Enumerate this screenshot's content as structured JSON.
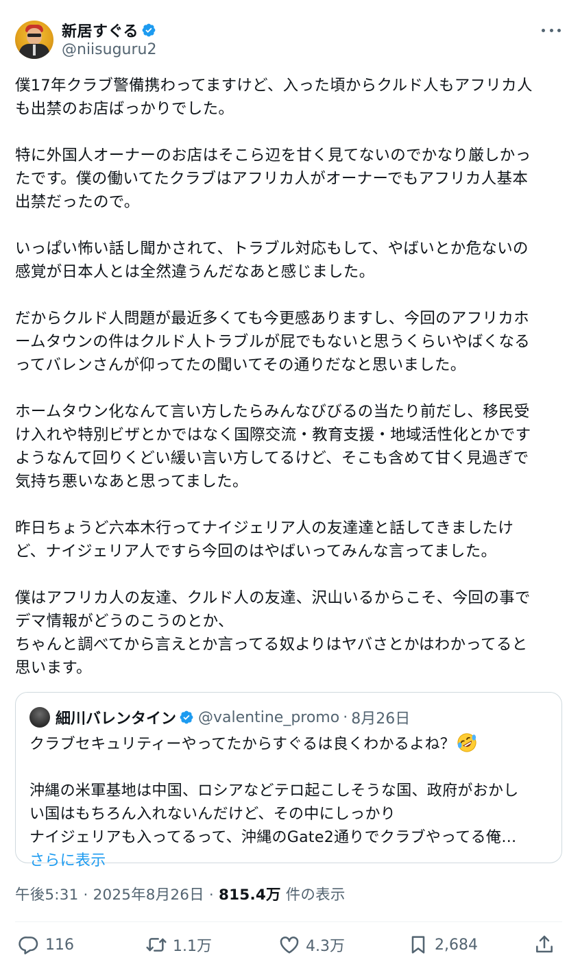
{
  "author": {
    "display_name": "新居すぐる",
    "handle": "@niisuguru2"
  },
  "tweet": {
    "paragraphs": [
      [
        "僕17年クラブ警備携わってますけど、入った頃からクルド人もアフリカ人",
        "も出禁のお店ばっかりでした。"
      ],
      [
        "特に外国人オーナーのお店はそこら辺を甘く見てないのでかなり厳しかっ",
        "たです。僕の働いてたクラブはアフリカ人がオーナーでもアフリカ人基本",
        "出禁だったので。"
      ],
      [
        "いっぱい怖い話し聞かされて、トラブル対応もして、やばいとか危ないの",
        "感覚が日本人とは全然違うんだなあと感じました。"
      ],
      [
        "だからクルド人問題が最近多くても今更感ありますし、今回のアフリカホ",
        "ームタウンの件はクルド人トラブルが屁でもないと思うくらいやばくなる",
        "ってバレンさんが仰ってたの聞いてその通りだなと思いました。"
      ],
      [
        "ホームタウン化なんて言い方したらみんなびびるの当たり前だし、移民受",
        "け入れや特別ビザとかではなく国際交流・教育支援・地域活性化とかです",
        "ようなんて回りくどい緩い言い方してるけど、そこも含めて甘く見過ぎで",
        "気持ち悪いなあと思ってました。"
      ],
      [
        "昨日ちょうど六本木行ってナイジェリア人の友達達と話してきましたけ",
        "ど、ナイジェリア人ですら今回のはやばいってみんな言ってました。"
      ],
      [
        "僕はアフリカ人の友達、クルド人の友達、沢山いるからこそ、今回の事で",
        "デマ情報がどうのこうのとか、",
        "ちゃんと調べてから言えとか言ってる奴よりはヤバさとかはわかってると",
        "思います。"
      ]
    ]
  },
  "quote": {
    "display_name": "細川バレンタイン",
    "handle": "@valentine_promo",
    "separator": "·",
    "date": "8月26日",
    "first_line": "クラブセキュリティーやってたからすぐるは良くわかるよね？",
    "emoji": "rolling-on-floor-laughing-emoji",
    "lines": [
      "沖縄の米軍基地は中国、ロシアなどテロ起こしそうな国、政府がおかし",
      "い国はもちろん入れないんだけど、その中にしっかり",
      "ナイジェリアも入ってるって、沖縄のGate2通りでクラブやってる俺…"
    ],
    "show_more": "さらに表示"
  },
  "meta": {
    "time": "午後5:31",
    "sep1": " · ",
    "date": "2025年8月26日",
    "sep2": " · ",
    "views": "815.4万",
    "views_label": " 件の表示"
  },
  "actions": {
    "replies": "116",
    "reposts": "1.1万",
    "likes": "4.3万",
    "bookmarks": "2,684"
  },
  "colors": {
    "text": "#0f1419",
    "secondary": "#536471",
    "accent": "#1d9bf0",
    "border": "#cfd9de"
  },
  "icons": [
    "verified-badge-icon",
    "more-options-icon",
    "reply-icon",
    "repost-icon",
    "like-icon",
    "bookmark-icon",
    "share-icon"
  ]
}
